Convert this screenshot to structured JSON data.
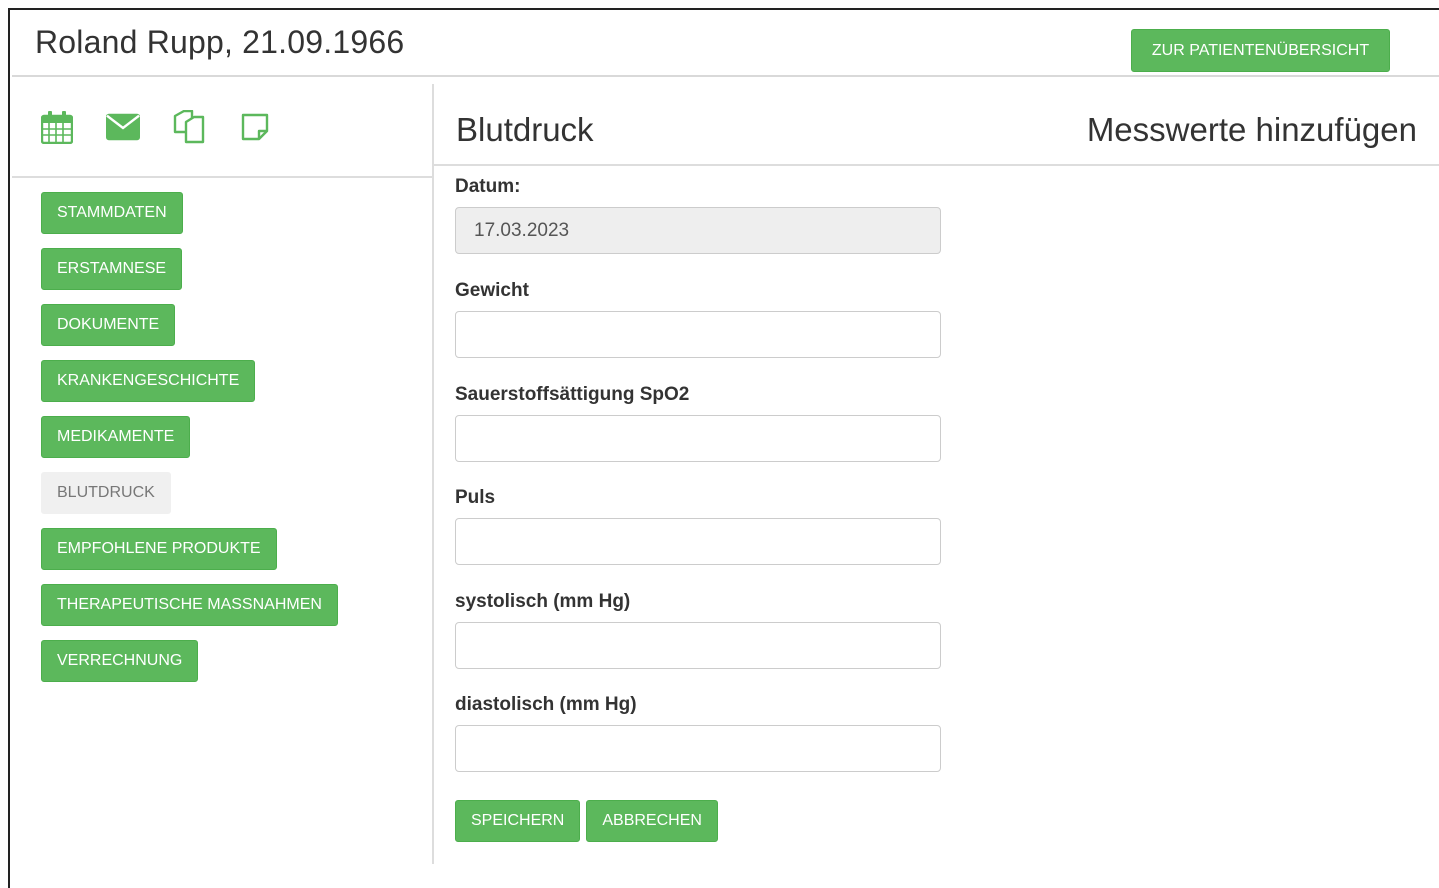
{
  "header": {
    "patient_title": "Roland Rupp, 21.09.1966",
    "overview_button": "ZUR PATIENTENÜBERSICHT"
  },
  "sidebar": {
    "icons": [
      "calendar-icon",
      "envelope-icon",
      "copy-icon",
      "note-icon"
    ],
    "items": [
      {
        "label": "STAMMDATEN",
        "active": false
      },
      {
        "label": "ERSTAMNESE",
        "active": false
      },
      {
        "label": "DOKUMENTE",
        "active": false
      },
      {
        "label": "KRANKENGESCHICHTE",
        "active": false
      },
      {
        "label": "MEDIKAMENTE",
        "active": false
      },
      {
        "label": "BLUTDRUCK",
        "active": true
      },
      {
        "label": "EMPFOHLENE PRODUKTE",
        "active": false
      },
      {
        "label": "THERAPEUTISCHE MASSNAHMEN",
        "active": false
      },
      {
        "label": "VERRECHNUNG",
        "active": false
      }
    ]
  },
  "main": {
    "title": "Blutdruck",
    "subtitle": "Messwerte hinzufügen",
    "form": {
      "datum_label": "Datum:",
      "datum_value": "17.03.2023",
      "gewicht_label": "Gewicht",
      "gewicht_value": "",
      "spo2_label": "Sauerstoffsättigung SpO2",
      "spo2_value": "",
      "puls_label": "Puls",
      "puls_value": "",
      "systolisch_label": "systolisch (mm Hg)",
      "systolisch_value": "",
      "diastolisch_label": "diastolisch (mm Hg)",
      "diastolisch_value": "",
      "save_button": "SPEICHERN",
      "cancel_button": "ABBRECHEN"
    }
  },
  "colors": {
    "accent_green": "#5cb85c",
    "active_item_bg": "#f0f0f0"
  }
}
